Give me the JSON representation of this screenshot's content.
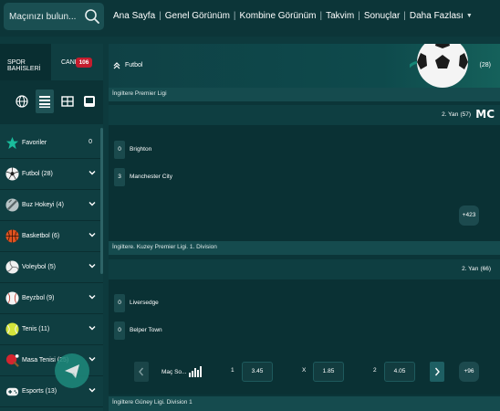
{
  "colors": {
    "accent": "#1abc9c",
    "live_badge": "#c41d2e",
    "background": "#0d3a3d"
  },
  "search": {
    "placeholder": "Maçınızı bulun..."
  },
  "topnav": {
    "items": [
      "Ana Sayfa",
      "Genel Görünüm",
      "Kombine Görünüm",
      "Takvim",
      "Sonuçlar",
      "Daha Fazlası"
    ]
  },
  "sidebar": {
    "tab_sports": "SPOR BAHİSLERİ",
    "tab_live": "CANLI",
    "live_count": "106",
    "view_icons": [
      "globe-icon",
      "list-icon",
      "grid-icon",
      "screen-icon"
    ],
    "items": [
      {
        "label": "Favoriler",
        "count": "0",
        "icon": "star-icon"
      },
      {
        "label": "Futbol (28)",
        "icon": "soccer-ball-icon"
      },
      {
        "label": "Buz Hokeyi (4)",
        "icon": "ice-hockey-icon"
      },
      {
        "label": "Basketbol (6)",
        "icon": "basketball-icon"
      },
      {
        "label": "Voleybol (5)",
        "icon": "volleyball-icon"
      },
      {
        "label": "Beyzbol (9)",
        "icon": "baseball-icon"
      },
      {
        "label": "Tenis (11)",
        "icon": "tennis-icon"
      },
      {
        "label": "Masa Tenisi (25)",
        "icon": "table-tennis-icon"
      },
      {
        "label": "Esports (13)",
        "icon": "gamepad-icon"
      }
    ]
  },
  "main": {
    "sport_title": "Futbol",
    "sport_count": "(28)",
    "matches": [
      {
        "league": "İngiltere Premier Ligi",
        "period": "2. Yarı",
        "minute": "(57)",
        "home": {
          "name": "Brighton",
          "score": "0"
        },
        "away": {
          "name": "Manchester City",
          "score": "3"
        },
        "more": "+423",
        "logo_text": "MC"
      },
      {
        "league": "İngiltere. Kuzey Premier Ligi. 1. Division",
        "period": "2. Yarı",
        "minute": "(66)",
        "home": {
          "name": "Liversedge",
          "score": "0"
        },
        "away": {
          "name": "Belper Town",
          "score": "0"
        },
        "market": "Maç So...",
        "odds": [
          {
            "label": "1",
            "value": "3.45"
          },
          {
            "label": "X",
            "value": "1.85"
          },
          {
            "label": "2",
            "value": "4.05"
          }
        ],
        "more": "+96"
      },
      {
        "league": "İngiltere Güney Ligi. Division 1"
      }
    ]
  }
}
